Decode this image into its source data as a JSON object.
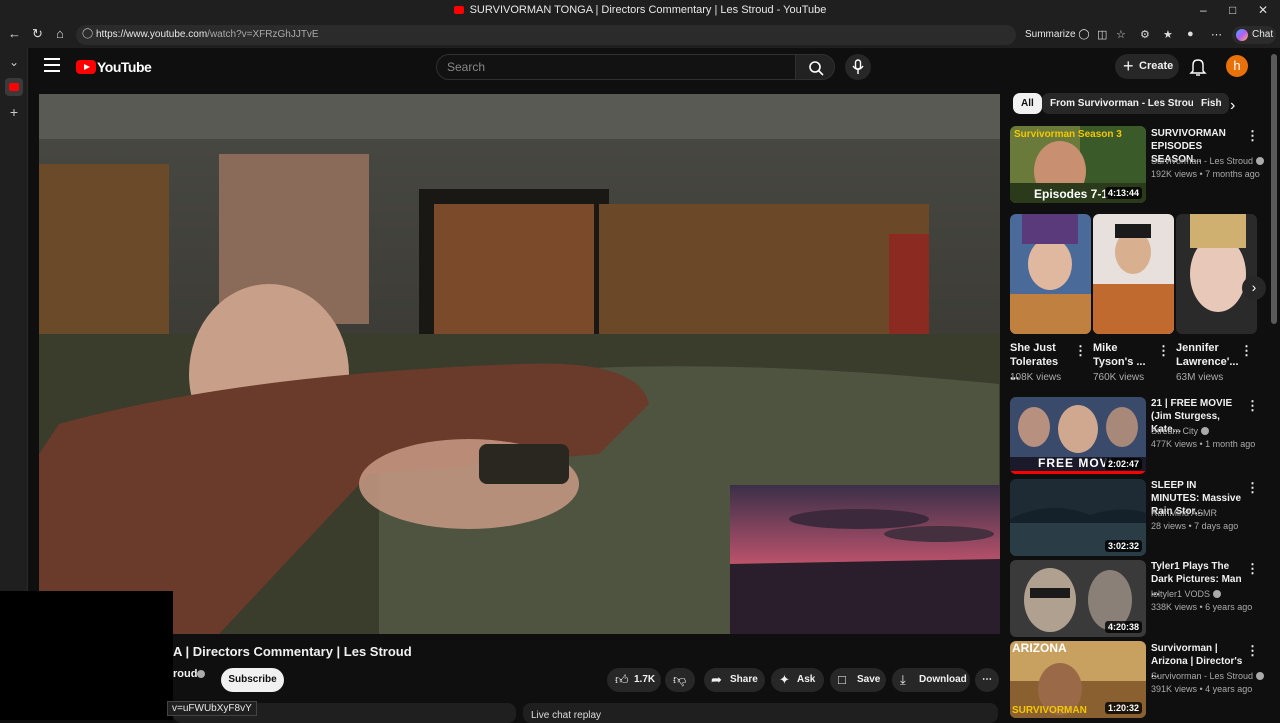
{
  "browser": {
    "window_title": "SURVIVORMAN TONGA | Directors Commentary | Les Stroud - YouTube",
    "url_host": "https://www.youtube.com",
    "url_path": "/watch?v=XFRzGhJJTvE",
    "summarize_label": "Summarize",
    "chat_label": "Chat"
  },
  "header": {
    "logo_text": "YouTube",
    "search_placeholder": "Search",
    "create_label": "Create",
    "avatar_letter": "h"
  },
  "video": {
    "title_visible": "A | Directors Commentary | Les Stroud",
    "channel_visible": "roud",
    "subscribe_label": "Subscribe",
    "likes": "1.7K",
    "share_label": "Share",
    "ask_label": "Ask",
    "save_label": "Save",
    "download_label": "Download",
    "link_tooltip": "v=uFWUbXyF8vY",
    "chat_replay_label": "Live chat replay"
  },
  "chips": [
    {
      "label": "All",
      "active": true
    },
    {
      "label": "From Survivorman - Les Stroud",
      "active": false
    },
    {
      "label": "Fish",
      "active": false
    }
  ],
  "recommendations_top": [
    {
      "title": "SURVIVORMAN EPISODES SEASON...",
      "channel": "Survivorman - Les Stroud",
      "meta": "192K views • 7 months ago",
      "duration": "4:13:44",
      "thumb_text_top": "Survivorman Season 3",
      "thumb_text_bottom": "Episodes 7-1"
    }
  ],
  "shorts": [
    {
      "title": "She Just Tolerates ...",
      "views": "108K views"
    },
    {
      "title": "Mike Tyson's ...",
      "views": "760K views"
    },
    {
      "title": "Jennifer Lawrence'...",
      "views": "63M views"
    }
  ],
  "recommendations": [
    {
      "title": "21 | FREE MOVIE (Jim Sturgess, Kate...",
      "channel": "Stream City",
      "meta": "477K views • 1 month ago",
      "duration": "2:02:47",
      "thumb_text": "FREE MOVI"
    },
    {
      "title": "SLEEP IN MINUTES: Massive Rain Stor...",
      "channel": "RainMind ASMR",
      "meta": "28 views • 7 days ago",
      "duration": "3:02:32",
      "thumb_text": ""
    },
    {
      "title": "Tyler1 Plays The Dark Pictures: Man ...",
      "channel": "loltyler1 VODS",
      "meta": "338K views • 6 years ago",
      "duration": "4:20:38",
      "thumb_text": ""
    },
    {
      "title": "Survivorman | Arizona | Director's ...",
      "channel": "Survivorman - Les Stroud",
      "meta": "391K views • 4 years ago",
      "duration": "1:20:32",
      "thumb_text": "ARIZONA",
      "thumb_text_bottom": "SURVIVORMAN"
    }
  ],
  "colors": {
    "background": "#0f0f0f",
    "brand_red": "#ff0000",
    "avatar": "#e8710a",
    "chip_active_bg": "#f1f1f1",
    "chip_bg": "#272727"
  }
}
